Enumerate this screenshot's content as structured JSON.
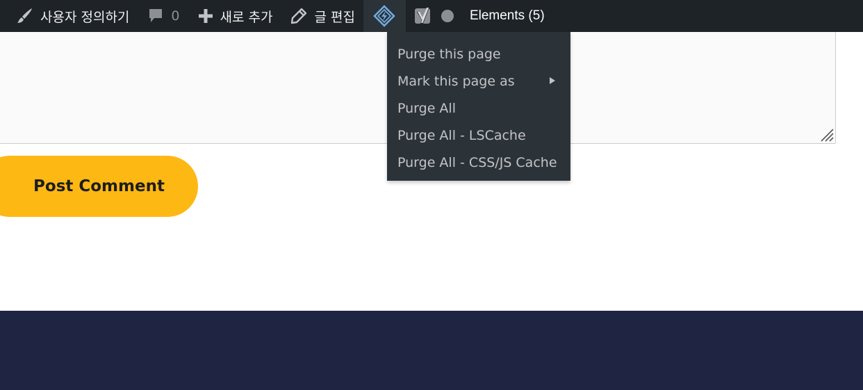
{
  "adminbar": {
    "customize_label": "사용자 정의하기",
    "comments_count": "0",
    "new_label": "새로 추가",
    "edit_label": "글 편집",
    "elements_label": "Elements (5)"
  },
  "litespeed_menu": {
    "items": [
      {
        "label": "Purge this page"
      },
      {
        "label": "Mark this page as",
        "has_submenu": true
      },
      {
        "label": "Purge All"
      },
      {
        "label": "Purge All - LSCache"
      },
      {
        "label": "Purge All - CSS/JS Cache"
      }
    ]
  },
  "comment_form": {
    "submit_label": "Post Comment"
  },
  "colors": {
    "adminbar_bg": "#1d2327",
    "dropdown_bg": "#2c3338",
    "button_bg": "#fdb813",
    "footer_bg": "#1f2442"
  },
  "icons": {
    "customize": "paintbrush-icon",
    "comments": "comment-bubble-icon",
    "new": "plus-icon",
    "edit": "pencil-icon",
    "litespeed": "litespeed-diamond-icon",
    "yoast": "yoast-icon",
    "status": "status-dot-icon",
    "submenu": "submenu-arrow-icon",
    "resize": "resize-handle-icon"
  }
}
